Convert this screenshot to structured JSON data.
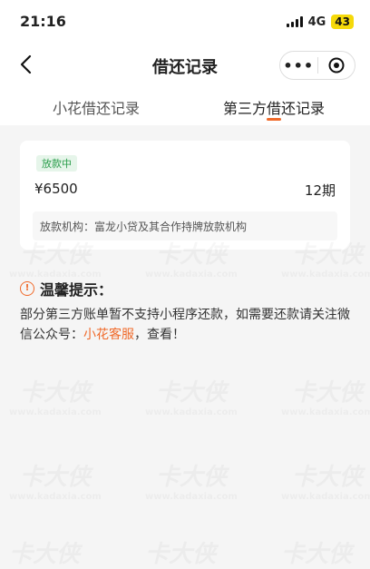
{
  "status_bar": {
    "time": "21:16",
    "network": "4G",
    "battery": "43"
  },
  "nav": {
    "title": "借还记录"
  },
  "tabs": [
    {
      "label": "小花借还记录",
      "active": false
    },
    {
      "label": "第三方借还记录",
      "active": true
    }
  ],
  "record": {
    "status": "放款中",
    "amount": "¥6500",
    "period": "12期",
    "lender": "放款机构：富龙小贷及其合作持牌放款机构"
  },
  "notice": {
    "title": "温馨提示：",
    "body_before": "部分第三方账单暂不支持小程序还款，如需要还款请关注微信公众号：",
    "link": "小花客服",
    "body_after": "，查看！"
  },
  "watermark": {
    "brand": "卡大侠",
    "url": "www.kadaxia.com"
  },
  "colors": {
    "accent": "#f06a2a",
    "status_green": "#2a9d4b"
  }
}
